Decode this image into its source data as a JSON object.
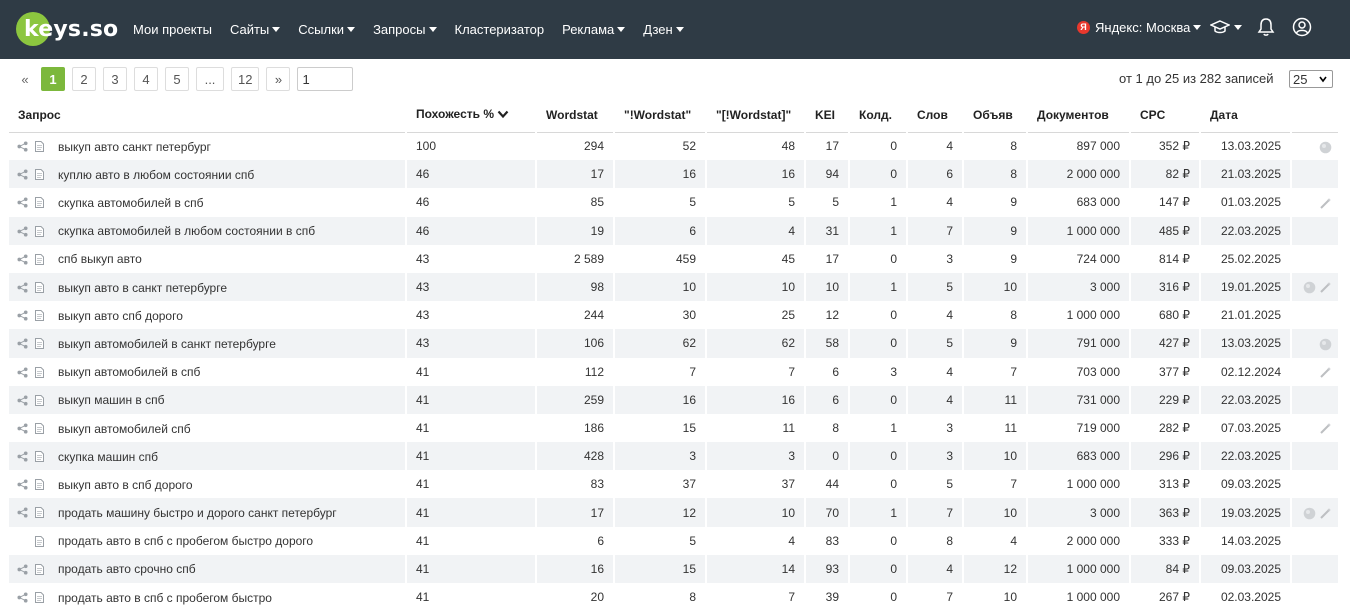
{
  "nav": {
    "logo_text": "keys.so",
    "menu": [
      {
        "label": "Мои проекты",
        "dropdown": false
      },
      {
        "label": "Сайты",
        "dropdown": true
      },
      {
        "label": "Ссылки",
        "dropdown": true
      },
      {
        "label": "Запросы",
        "dropdown": true
      },
      {
        "label": "Кластеризатор",
        "dropdown": false
      },
      {
        "label": "Реклама",
        "dropdown": true
      },
      {
        "label": "Дзен",
        "dropdown": true
      }
    ],
    "region_badge": "Я",
    "region_label": "Яндекс: Москва",
    "icons": [
      "graduation-cap-icon",
      "bell-icon",
      "user-icon"
    ]
  },
  "pagination": {
    "prev": "«",
    "pages": [
      "1",
      "2",
      "3",
      "4",
      "5",
      "...",
      "12"
    ],
    "active": "1",
    "next": "»",
    "jump_value": "1"
  },
  "records_info": "от 1 до 25 из 282 записей",
  "per_page": "25",
  "table": {
    "columns": [
      "Запрос",
      "Похожесть %",
      "Wordstat",
      "\"!Wordstat\"",
      "\"[!Wordstat]\"",
      "KEI",
      "Колд.",
      "Слов",
      "Объяв",
      "Документов",
      "CPC",
      "Дата",
      ""
    ],
    "sorted_column": "Похожесть %",
    "rows": [
      {
        "query": "выкуп авто санкт петербург",
        "sim": "100",
        "ws": "294",
        "ws2": "52",
        "ws3": "48",
        "kei": "17",
        "kold": "0",
        "words": "4",
        "ads": "8",
        "docs": "897 000",
        "cpc": "352 ₽",
        "date": "13.03.2025",
        "actions": [
          "globe-icon"
        ],
        "share": true
      },
      {
        "query": "куплю авто в любом состоянии спб",
        "sim": "46",
        "ws": "17",
        "ws2": "16",
        "ws3": "16",
        "kei": "94",
        "kold": "0",
        "words": "6",
        "ads": "8",
        "docs": "2 000 000",
        "cpc": "82 ₽",
        "date": "21.03.2025",
        "actions": [],
        "share": true
      },
      {
        "query": "скупка автомобилей в спб",
        "sim": "46",
        "ws": "85",
        "ws2": "5",
        "ws3": "5",
        "kei": "5",
        "kold": "1",
        "words": "4",
        "ads": "9",
        "docs": "683 000",
        "cpc": "147 ₽",
        "date": "01.03.2025",
        "actions": [
          "wand-icon"
        ],
        "share": true
      },
      {
        "query": "скупка автомобилей в любом состоянии в спб",
        "sim": "46",
        "ws": "19",
        "ws2": "6",
        "ws3": "4",
        "kei": "31",
        "kold": "1",
        "words": "7",
        "ads": "9",
        "docs": "1 000 000",
        "cpc": "485 ₽",
        "date": "22.03.2025",
        "actions": [],
        "share": true
      },
      {
        "query": "спб выкуп авто",
        "sim": "43",
        "ws": "2 589",
        "ws2": "459",
        "ws3": "45",
        "kei": "17",
        "kold": "0",
        "words": "3",
        "ads": "9",
        "docs": "724 000",
        "cpc": "814 ₽",
        "date": "25.02.2025",
        "actions": [],
        "share": true
      },
      {
        "query": "выкуп авто в санкт петербурге",
        "sim": "43",
        "ws": "98",
        "ws2": "10",
        "ws3": "10",
        "kei": "10",
        "kold": "1",
        "words": "5",
        "ads": "10",
        "docs": "3 000",
        "cpc": "316 ₽",
        "date": "19.01.2025",
        "actions": [
          "globe-icon",
          "wand-icon"
        ],
        "share": true
      },
      {
        "query": "выкуп авто спб дорого",
        "sim": "43",
        "ws": "244",
        "ws2": "30",
        "ws3": "25",
        "kei": "12",
        "kold": "0",
        "words": "4",
        "ads": "8",
        "docs": "1 000 000",
        "cpc": "680 ₽",
        "date": "21.01.2025",
        "actions": [],
        "share": true
      },
      {
        "query": "выкуп автомобилей в санкт петербурге",
        "sim": "43",
        "ws": "106",
        "ws2": "62",
        "ws3": "62",
        "kei": "58",
        "kold": "0",
        "words": "5",
        "ads": "9",
        "docs": "791 000",
        "cpc": "427 ₽",
        "date": "13.03.2025",
        "actions": [
          "globe-icon"
        ],
        "share": true
      },
      {
        "query": "выкуп автомобилей в спб",
        "sim": "41",
        "ws": "112",
        "ws2": "7",
        "ws3": "7",
        "kei": "6",
        "kold": "3",
        "words": "4",
        "ads": "7",
        "docs": "703 000",
        "cpc": "377 ₽",
        "date": "02.12.2024",
        "actions": [
          "wand-icon"
        ],
        "share": true
      },
      {
        "query": "выкуп машин в спб",
        "sim": "41",
        "ws": "259",
        "ws2": "16",
        "ws3": "16",
        "kei": "6",
        "kold": "0",
        "words": "4",
        "ads": "11",
        "docs": "731 000",
        "cpc": "229 ₽",
        "date": "22.03.2025",
        "actions": [],
        "share": true
      },
      {
        "query": "выкуп автомобилей спб",
        "sim": "41",
        "ws": "186",
        "ws2": "15",
        "ws3": "11",
        "kei": "8",
        "kold": "1",
        "words": "3",
        "ads": "11",
        "docs": "719 000",
        "cpc": "282 ₽",
        "date": "07.03.2025",
        "actions": [
          "wand-icon"
        ],
        "share": true
      },
      {
        "query": "скупка машин спб",
        "sim": "41",
        "ws": "428",
        "ws2": "3",
        "ws3": "3",
        "kei": "0",
        "kold": "0",
        "words": "3",
        "ads": "10",
        "docs": "683 000",
        "cpc": "296 ₽",
        "date": "22.03.2025",
        "actions": [],
        "share": true
      },
      {
        "query": "выкуп авто в спб дорого",
        "sim": "41",
        "ws": "83",
        "ws2": "37",
        "ws3": "37",
        "kei": "44",
        "kold": "0",
        "words": "5",
        "ads": "7",
        "docs": "1 000 000",
        "cpc": "313 ₽",
        "date": "09.03.2025",
        "actions": [],
        "share": true
      },
      {
        "query": "продать машину быстро и дорого санкт петербург",
        "sim": "41",
        "ws": "17",
        "ws2": "12",
        "ws3": "10",
        "kei": "70",
        "kold": "1",
        "words": "7",
        "ads": "10",
        "docs": "3 000",
        "cpc": "363 ₽",
        "date": "19.03.2025",
        "actions": [
          "globe-icon",
          "wand-icon"
        ],
        "share": true
      },
      {
        "query": "продать авто в спб с пробегом быстро дорого",
        "sim": "41",
        "ws": "6",
        "ws2": "5",
        "ws3": "4",
        "kei": "83",
        "kold": "0",
        "words": "8",
        "ads": "4",
        "docs": "2 000 000",
        "cpc": "333 ₽",
        "date": "14.03.2025",
        "actions": [],
        "share": false
      },
      {
        "query": "продать авто срочно спб",
        "sim": "41",
        "ws": "16",
        "ws2": "15",
        "ws3": "14",
        "kei": "93",
        "kold": "0",
        "words": "4",
        "ads": "12",
        "docs": "1 000 000",
        "cpc": "84 ₽",
        "date": "09.03.2025",
        "actions": [],
        "share": true
      },
      {
        "query": "продать авто в спб с пробегом быстро",
        "sim": "41",
        "ws": "20",
        "ws2": "8",
        "ws3": "7",
        "kei": "39",
        "kold": "0",
        "words": "7",
        "ads": "10",
        "docs": "1 000 000",
        "cpc": "267 ₽",
        "date": "02.03.2025",
        "actions": [],
        "share": true
      }
    ]
  },
  "colors": {
    "nav_bg": "#2f3b45",
    "accent": "#7cb83c",
    "row_alt": "#f1f3f5"
  }
}
